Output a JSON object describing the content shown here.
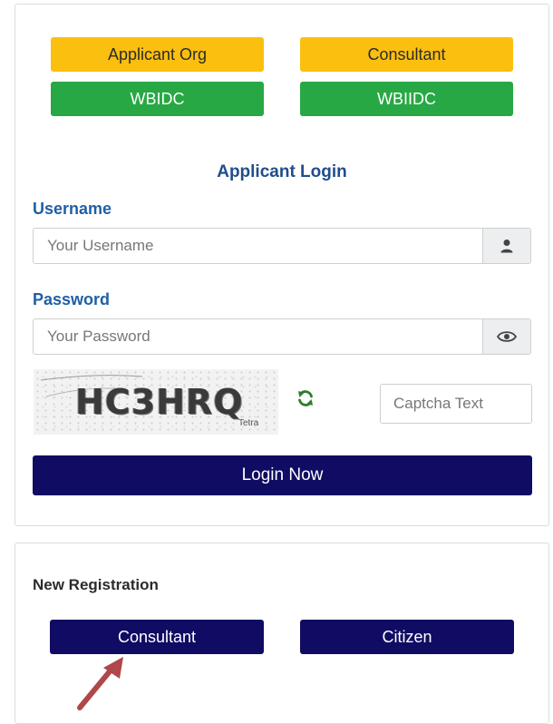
{
  "role_buttons": {
    "applicant_org": "Applicant Org",
    "consultant": "Consultant",
    "wbidc": "WBIDC",
    "wbiidc": "WBIIDC"
  },
  "login": {
    "title": "Applicant Login",
    "username_label": "Username",
    "username_placeholder": "Your Username",
    "password_label": "Password",
    "password_placeholder": "Your Password",
    "captcha_code": "HC3HRQ",
    "captcha_subtext": "Tetra",
    "captcha_placeholder": "Captcha Text",
    "submit_label": "Login Now"
  },
  "registration": {
    "title": "New Registration",
    "consultant_label": "Consultant",
    "citizen_label": "Citizen"
  },
  "icons": {
    "username_addon": "user-icon",
    "password_addon": "eye-icon",
    "captcha_refresh": "refresh-icon",
    "annotation": "arrow-icon"
  },
  "colors": {
    "yellow_button": "#fbbf0f",
    "green_button": "#27a844",
    "navy_button": "#100c63",
    "label_blue": "#1f5fa6",
    "arrow": "#b0474a"
  }
}
